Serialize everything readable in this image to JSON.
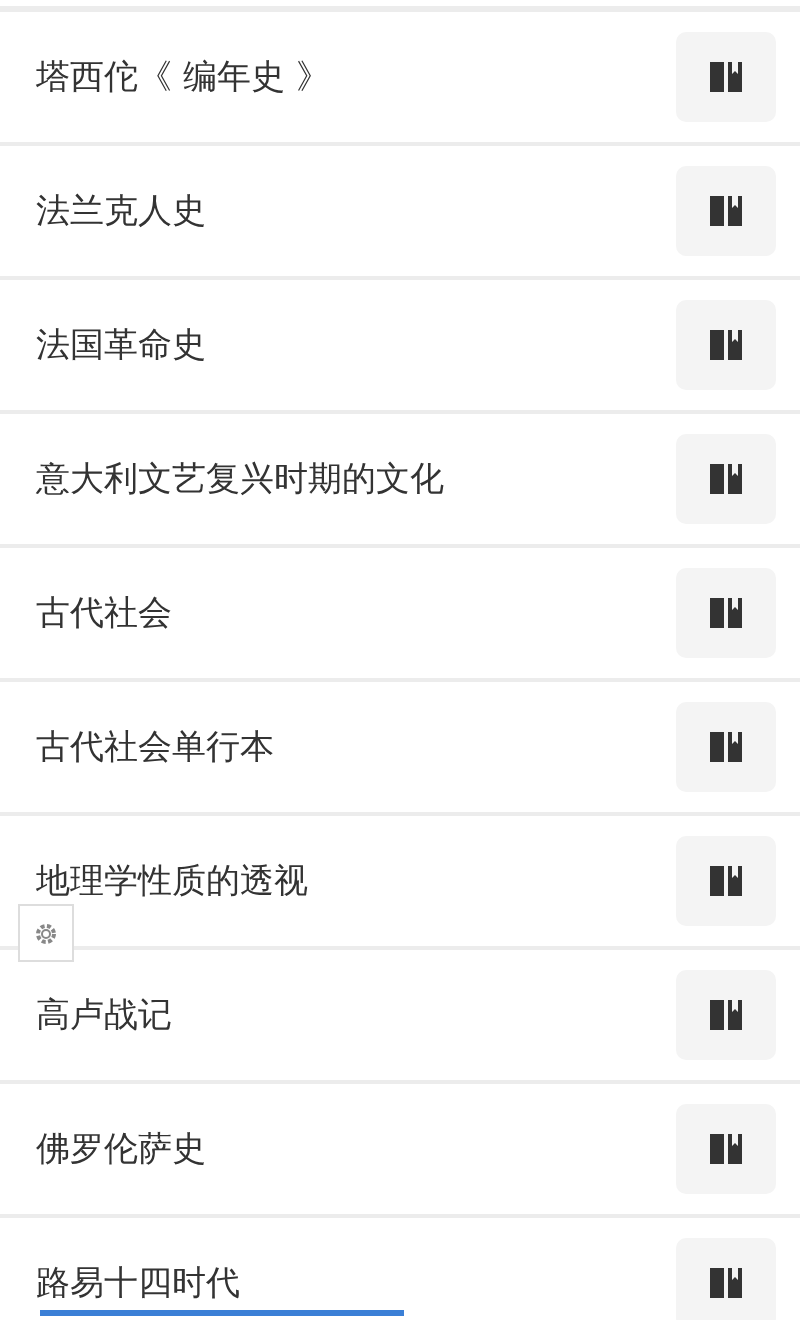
{
  "books": [
    {
      "title": "塔西佗《 编年史 》"
    },
    {
      "title": "法兰克人史"
    },
    {
      "title": "法国革命史"
    },
    {
      "title": "意大利文艺复兴时期的文化"
    },
    {
      "title": "古代社会"
    },
    {
      "title": "古代社会单行本"
    },
    {
      "title": "地理学性质的透视"
    },
    {
      "title": "高卢战记"
    },
    {
      "title": "佛罗伦萨史"
    },
    {
      "title": "路易十四时代"
    }
  ]
}
